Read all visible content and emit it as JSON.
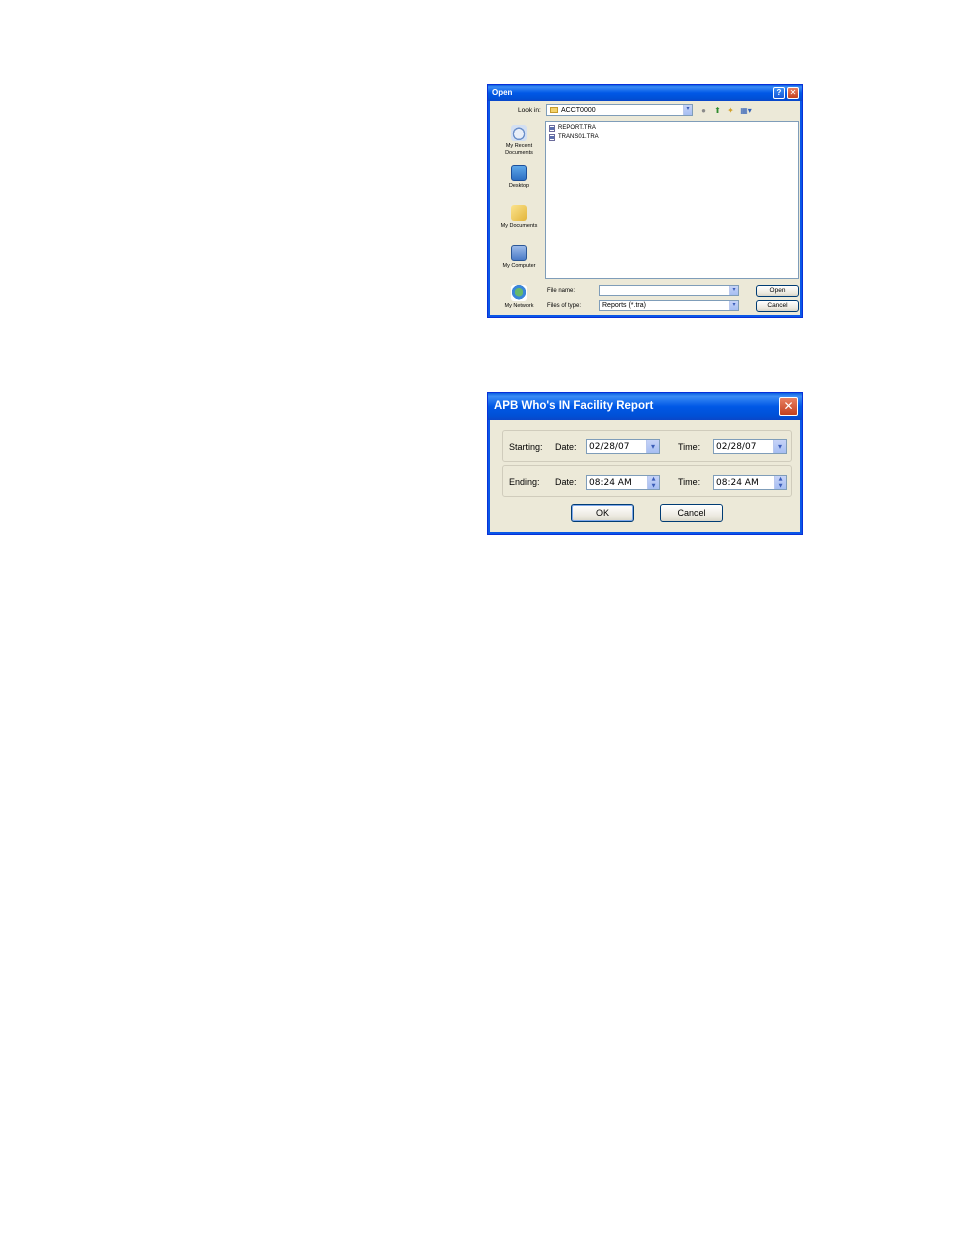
{
  "open_dialog": {
    "title": "Open",
    "help_glyph": "?",
    "close_glyph": "✕",
    "look_in_label": "Look in:",
    "look_in_value": "ACCT0000",
    "toolbar_icons": [
      "back-icon",
      "up-folder-icon",
      "new-folder-icon",
      "views-menu-icon"
    ],
    "places": [
      {
        "label_line1": "My Recent",
        "label_line2": "Documents",
        "icon": "recent-documents-icon"
      },
      {
        "label_line1": "Desktop",
        "label_line2": "",
        "icon": "desktop-icon"
      },
      {
        "label_line1": "My Documents",
        "label_line2": "",
        "icon": "my-documents-icon"
      },
      {
        "label_line1": "My Computer",
        "label_line2": "",
        "icon": "my-computer-icon"
      },
      {
        "label_line1": "My Network",
        "label_line2": "",
        "icon": "my-network-icon"
      }
    ],
    "files": [
      "REPORT.TRA",
      "TRANS01.TRA"
    ],
    "file_name_label": "File name:",
    "file_name_value": "",
    "files_of_type_label": "Files of type:",
    "files_of_type_value": "Reports (*.tra)",
    "open_label": "Open",
    "cancel_label": "Cancel"
  },
  "report_dialog": {
    "title": "APB Who's IN Facility Report",
    "close_glyph": "✕",
    "starting_label": "Starting:",
    "ending_label": "Ending:",
    "date_label": "Date:",
    "time_label": "Time:",
    "starting_date": "02/28/07",
    "starting_time": "02/28/07",
    "ending_date": "08:24 AM",
    "ending_time": "08:24 AM",
    "ok_label": "OK",
    "cancel_label": "Cancel"
  }
}
